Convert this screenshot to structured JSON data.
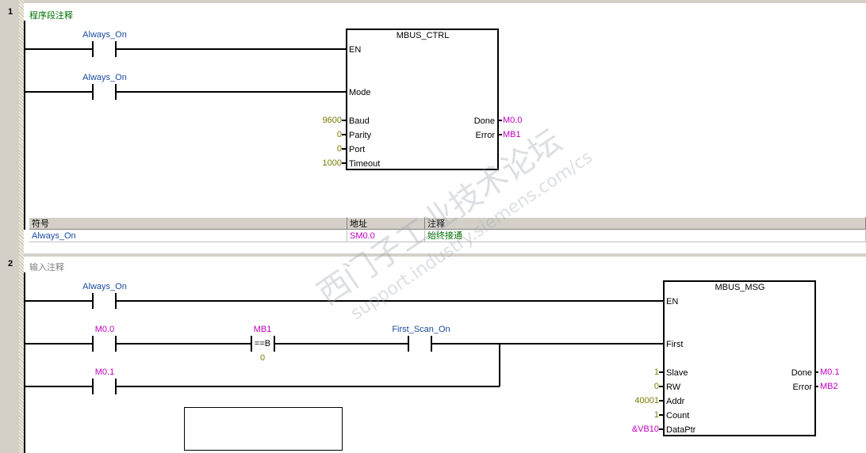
{
  "networks": [
    {
      "number": "1",
      "comment": "程序段注释",
      "contacts": [
        "Always_On",
        "Always_On"
      ],
      "box": {
        "title": "MBUS_CTRL",
        "in_pins": [
          "EN",
          "Mode",
          "Baud",
          "Parity",
          "Port",
          "Timeout"
        ],
        "in_values": [
          "",
          "",
          "9600",
          "0",
          "0",
          "1000"
        ],
        "out_pins": [
          "Done",
          "Error"
        ],
        "out_values": [
          "M0.0",
          "MB1"
        ]
      },
      "symbol_table": {
        "headers": [
          "符号",
          "地址",
          "注释"
        ],
        "rows": [
          [
            "Always_On",
            "SM0.0",
            "始终接通"
          ]
        ]
      }
    },
    {
      "number": "2",
      "comment": "输入注释",
      "contacts": [
        "Always_On",
        "M0.0",
        "M0.1",
        "First_Scan_On"
      ],
      "compare": {
        "operand1": "MB1",
        "op": "==B",
        "operand2": "0"
      },
      "box": {
        "title": "MBUS_MSG",
        "in_pins": [
          "EN",
          "First",
          "Slave",
          "RW",
          "Addr",
          "Count",
          "DataPtr"
        ],
        "in_values": [
          "",
          "",
          "1",
          "0",
          "40001",
          "1",
          "&VB10"
        ],
        "out_pins": [
          "Done",
          "Error"
        ],
        "out_values": [
          "M0.1",
          "MB2"
        ]
      }
    }
  ],
  "watermark": {
    "line1": "西门子工业",
    "line2": "技术论坛",
    "url": "support.industry.siemens.com/cs"
  }
}
